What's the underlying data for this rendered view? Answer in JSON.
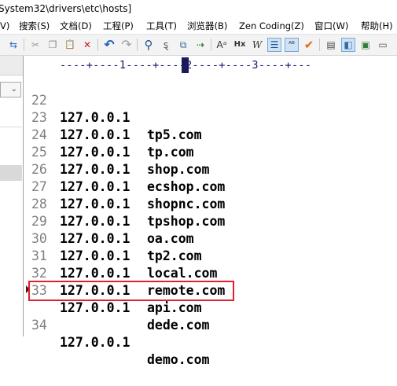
{
  "window": {
    "title": "System32\\drivers\\etc\\hosts]"
  },
  "menu": {
    "items": [
      {
        "label": "V)"
      },
      {
        "label": "搜索(S)"
      },
      {
        "label": "文档(D)"
      },
      {
        "label": "工程(P)"
      },
      {
        "label": "工具(T)"
      },
      {
        "label": "浏览器(B)"
      },
      {
        "label": "Zen Coding(Z)"
      },
      {
        "label": "窗口(W)"
      },
      {
        "label": "帮助(H)"
      }
    ]
  },
  "toolbar": {
    "buttons": [
      {
        "icon": "indent-icon",
        "glyph": "⇆"
      },
      {
        "icon": "cut-icon",
        "glyph": "✂"
      },
      {
        "icon": "copy-icon",
        "glyph": "❐"
      },
      {
        "icon": "paste-icon",
        "glyph": "📋"
      },
      {
        "icon": "delete-icon",
        "glyph": "✕"
      },
      {
        "icon": "undo-icon",
        "glyph": "↶"
      },
      {
        "icon": "redo-icon",
        "glyph": "↷"
      },
      {
        "icon": "find-icon",
        "glyph": "⚲"
      },
      {
        "icon": "replace-icon",
        "glyph": "ȿ"
      },
      {
        "icon": "find-in-files-icon",
        "glyph": "⧉"
      },
      {
        "icon": "jump-icon",
        "glyph": "⇢"
      },
      {
        "icon": "font-size-icon",
        "glyph": "Aᵃ"
      },
      {
        "icon": "hex-icon",
        "glyph": "Hx"
      },
      {
        "icon": "word-wrap-icon",
        "glyph": "W"
      },
      {
        "icon": "line-numbers-icon",
        "glyph": "☰"
      },
      {
        "icon": "spell-check-icon",
        "glyph": "ᴬᴮ"
      },
      {
        "icon": "check-icon",
        "glyph": "✔"
      },
      {
        "icon": "view-icon",
        "glyph": "▤"
      },
      {
        "icon": "split-view-icon",
        "glyph": "◧"
      },
      {
        "icon": "browser-icon",
        "glyph": "▣"
      },
      {
        "icon": "window-icon",
        "glyph": "▭"
      }
    ]
  },
  "ruler": {
    "text": "----+----1----+----2----+----3----+---"
  },
  "left_panel": {
    "combo_arrow": "⌄"
  },
  "editor": {
    "lines": [
      {
        "num": "22",
        "ip": "127.0.0.1",
        "host": "tp5.com"
      },
      {
        "num": "23",
        "ip": "127.0.0.1",
        "host": "tp.com"
      },
      {
        "num": "24",
        "ip": "127.0.0.1",
        "host": "shop.com"
      },
      {
        "num": "25",
        "ip": "127.0.0.1",
        "host": "ecshop.com"
      },
      {
        "num": "26",
        "ip": "127.0.0.1",
        "host": "shopnc.com"
      },
      {
        "num": "27",
        "ip": "127.0.0.1",
        "host": "tpshop.com"
      },
      {
        "num": "28",
        "ip": "127.0.0.1",
        "host": "oa.com"
      },
      {
        "num": "29",
        "ip": "127.0.0.1",
        "host": "tp2.com"
      },
      {
        "num": "30",
        "ip": "127.0.0.1",
        "host": "local.com"
      },
      {
        "num": "31",
        "ip": "127.0.0.1",
        "host": "remote.com"
      },
      {
        "num": "32",
        "ip": "127.0.0.1",
        "host": "api.com"
      },
      {
        "num": "33",
        "ip": "127.0.0.1",
        "host": "dede.com"
      },
      {
        "num": "34",
        "ip": "127.0.0.1",
        "host": "demo.com"
      }
    ],
    "highlighted_line": "34",
    "highlight_color": "#e0202a"
  }
}
